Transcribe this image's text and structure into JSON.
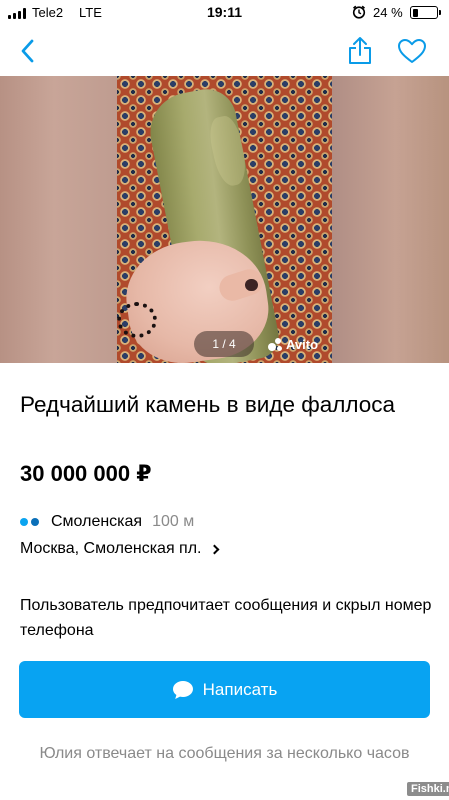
{
  "status_bar": {
    "carrier": "Tele2",
    "network": "LTE",
    "time": "19:11",
    "battery_percent_text": "24 %",
    "battery_level": 0.24
  },
  "nav": {
    "back_icon": "chevron-left-icon",
    "share_icon": "share-icon",
    "favorite_icon": "heart-icon",
    "accent_color": "#0a9be8"
  },
  "gallery": {
    "counter": "1 / 4",
    "watermark": "Avito"
  },
  "listing": {
    "title": "Редчайший камень в виде фаллоса",
    "price": "30 000 000 ₽",
    "metro_station": "Смоленская",
    "metro_distance": "100 м",
    "metro_line_colors": [
      "#0aa4f0",
      "#0a6fb8"
    ],
    "address": "Москва, Смоленская пл."
  },
  "contact": {
    "note": "Пользователь предпочитает сообщения и скрыл номер телефона",
    "write_button_label": "Написать",
    "button_color": "#08a3f2",
    "reply_note": "Юлия отвечает на сообщения за несколько часов"
  },
  "site_mark": "Fishki.net"
}
